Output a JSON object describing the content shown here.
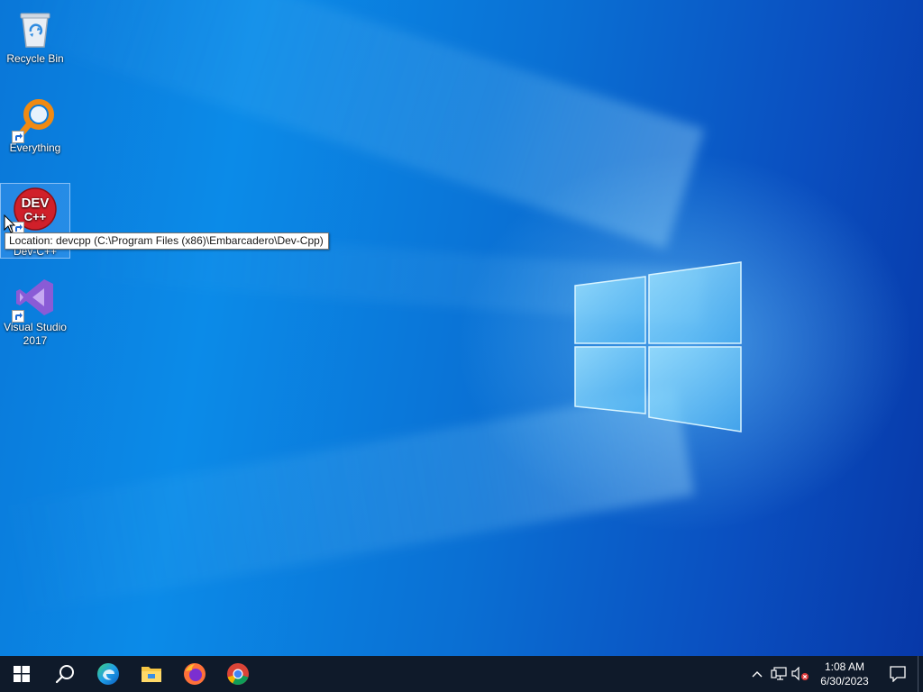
{
  "desktop": {
    "icons": [
      {
        "label": "Recycle Bin",
        "icon": "recycle-bin-icon"
      },
      {
        "label": "Everything",
        "icon": "everything-search-icon",
        "shortcut": true
      },
      {
        "label": "Dev-C++",
        "icon": "devcpp-icon",
        "shortcut": true,
        "selected": true
      },
      {
        "label": "Visual Studio 2017",
        "icon": "visual-studio-icon",
        "shortcut": true
      }
    ],
    "devcpp_icon_text_top": "DEV",
    "devcpp_icon_text_bottom": "C++",
    "tooltip": "Location: devcpp (C:\\Program Files (x86)\\Embarcadero\\Dev-Cpp)"
  },
  "taskbar": {
    "start": "windows-start-icon",
    "search": "search-icon",
    "pinned": [
      {
        "name": "edge-icon"
      },
      {
        "name": "file-explorer-icon"
      },
      {
        "name": "firefox-icon"
      },
      {
        "name": "chrome-icon"
      }
    ],
    "tray": {
      "chevron": "chevron-up-icon",
      "network": "network-icon",
      "volume": "volume-muted-icon",
      "time": "1:08 AM",
      "date": "6/30/2023",
      "notifications": "action-center-icon"
    }
  },
  "colors": {
    "taskbar_bg": "#0f1a2a",
    "desktop_accent": "#0b8be8"
  }
}
